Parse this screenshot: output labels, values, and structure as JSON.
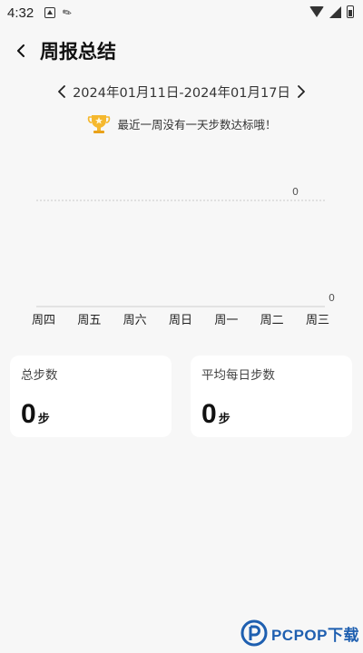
{
  "status_bar": {
    "time": "4:32"
  },
  "header": {
    "title": "周报总结"
  },
  "date_range": {
    "text": "2024年01月11日-2024年01月17日"
  },
  "notice": {
    "text": "最近一周没有一天步数达标哦！"
  },
  "chart_data": {
    "type": "line",
    "categories": [
      "周四",
      "周五",
      "周六",
      "周日",
      "周一",
      "周二",
      "周三"
    ],
    "series": [
      {
        "values": [
          0,
          0,
          0,
          0,
          0,
          0,
          0
        ]
      }
    ],
    "y_ticks": [
      "0",
      "0"
    ],
    "title": "",
    "xlabel": "",
    "ylabel": ""
  },
  "cards": {
    "total": {
      "label": "总步数",
      "value": "0",
      "unit": "步"
    },
    "average": {
      "label": "平均每日步数",
      "value": "0",
      "unit": "步"
    }
  },
  "watermark": {
    "text": "PCPOP下载"
  },
  "colors": {
    "background": "#f7f7f7",
    "card": "#ffffff",
    "watermark": "#1e5fb0",
    "trophy": "#f5b82e"
  }
}
